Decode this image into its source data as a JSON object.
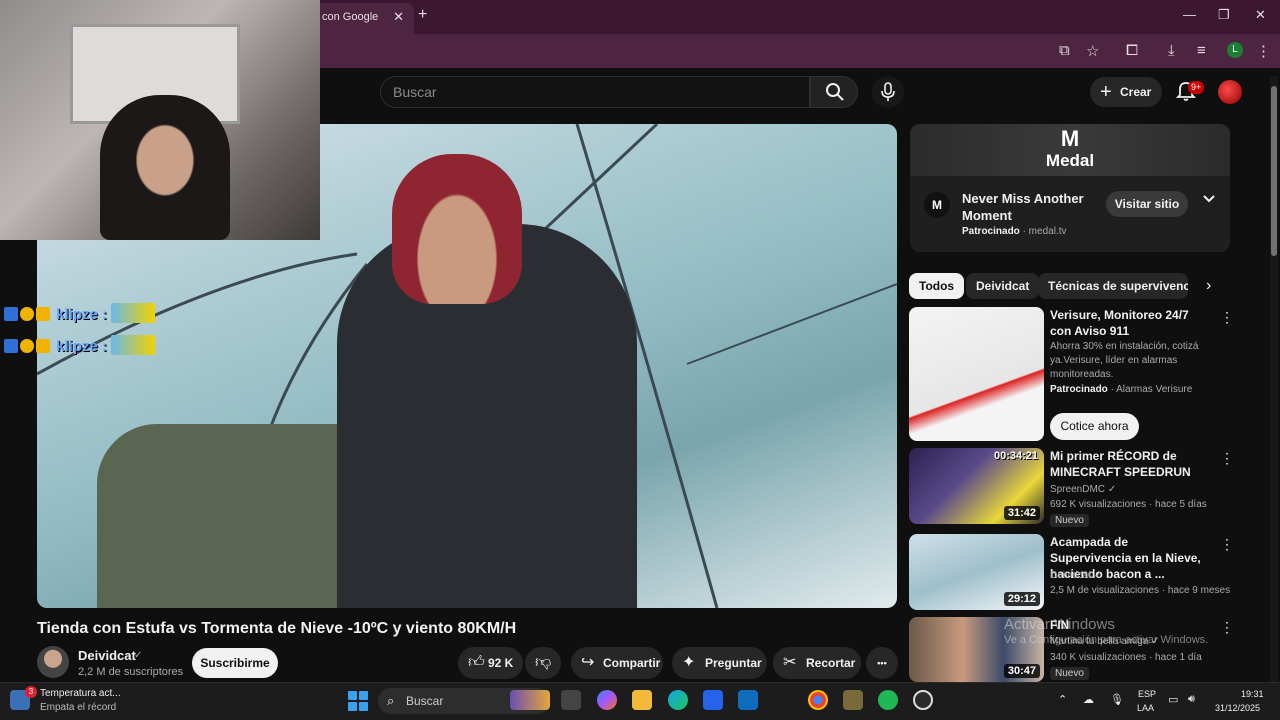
{
  "browser": {
    "tab_title": "con Google",
    "tab_close": "✕",
    "new_tab": "+",
    "window_controls": [
      "—",
      "❐",
      "✕"
    ],
    "profile_letter": "L"
  },
  "header": {
    "search_placeholder": "Buscar",
    "create_label": "Crear",
    "create_icon": "+",
    "notifications_badge": "9+"
  },
  "chat_overlay": [
    {
      "user": "klipze :"
    },
    {
      "user": "klipze :"
    }
  ],
  "video": {
    "title": "Tienda con Estufa vs Tormenta de Nieve -10ºC y viento 80KM/H",
    "channel": "Deividcat",
    "verified": "✓",
    "subscribers": "2,2 M de suscriptores",
    "subscribe_label": "Suscribirme",
    "likes": "92 K",
    "share_label": "Compartir",
    "ask_label": "Preguntar",
    "clip_label": "Recortar",
    "more_label": "•••"
  },
  "ad": {
    "logo_text": "Medal",
    "logo_mark": "M",
    "icon_letter": "M",
    "title": "Never Miss Another Moment",
    "sponsored": "Patrocinado",
    "domain": "· medal.tv",
    "visit_label": "Visitar sitio",
    "expand_icon": "chevron-down-icon"
  },
  "chips": [
    "Todos",
    "Deividcat",
    "Técnicas de supervivencia"
  ],
  "related": [
    {
      "title": "Verisure, Monitoreo 24/7 con Aviso 911",
      "desc": "Ahorra 30% en instalación, cotizá ya.Verisure, líder en alarmas monitoreadas.",
      "sponsored": "Patrocinado",
      "advertiser": "· Alarmas Verisure",
      "cta": "Cotice ahora"
    },
    {
      "title": "Mi primer RÉCORD de MINECRAFT SPEEDRUN",
      "channel": "SpreenDMC",
      "meta": "692 K visualizaciones · hace 5 días",
      "badge": "Nuevo",
      "duration": "31:42",
      "overlay_time": "00:34:21"
    },
    {
      "title": "Acampada de Supervivencia en la Nieve, haciendo bacon a ...",
      "channel": "Deividcat",
      "meta": "2,5 M de visualizaciones · hace 9 meses",
      "duration": "29:12"
    },
    {
      "title": "FIN",
      "channel": "Martina tu bella amiga",
      "meta": "340 K visualizaciones · hace 1 día",
      "badge": "Nuevo",
      "duration": "30:47"
    }
  ],
  "watermark": {
    "line1": "Activar Windows",
    "line2": "Ve a Configuración para activar Windows."
  },
  "taskbar": {
    "weather_title": "Temperatura act...",
    "weather_sub": "Empata el récord",
    "weather_badge": "3",
    "search_placeholder": "Buscar",
    "lang1": "ESP",
    "lang2": "LAA",
    "time": "19:31",
    "date": "31/12/2025"
  },
  "colors": {
    "youtube_bg": "#0f0f0f",
    "browser_frame": "#4e2541",
    "chat_name": "#6aa6ff",
    "notification_red": "#cc0000"
  }
}
